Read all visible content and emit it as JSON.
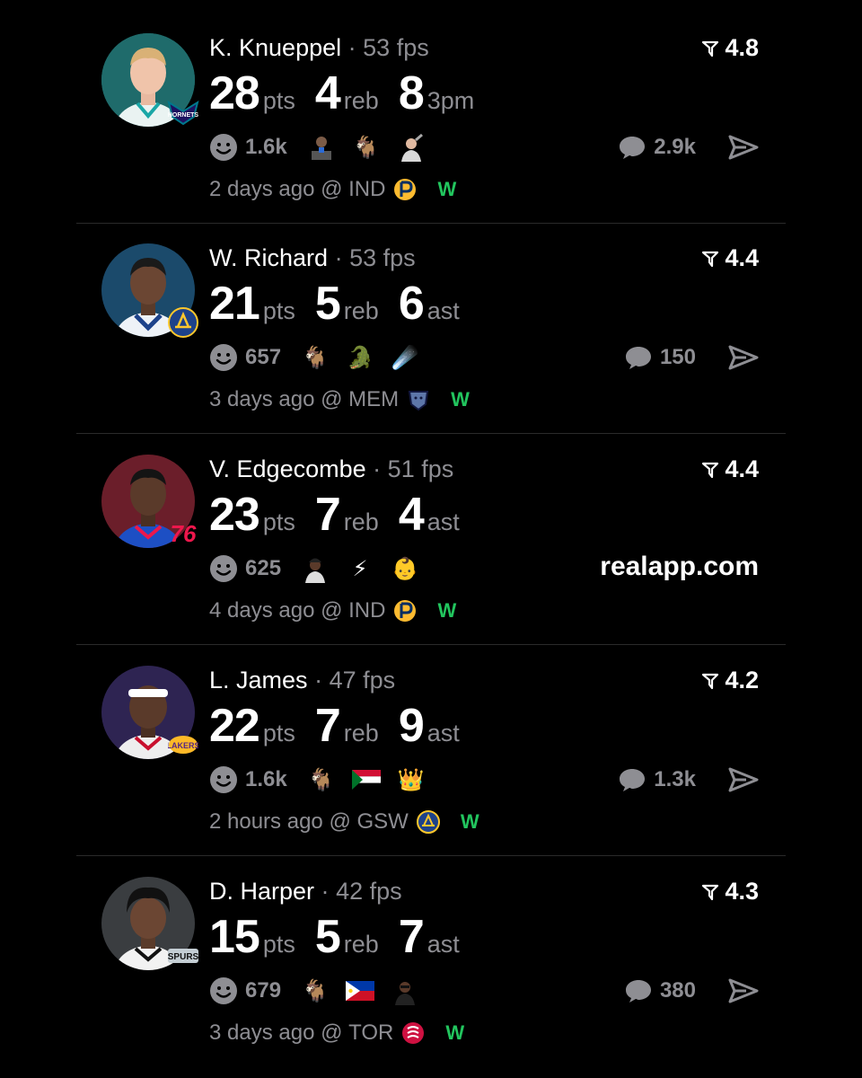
{
  "ui": {
    "colors": {
      "background": "#000000",
      "muted": "#8e8e93",
      "win": "#22c55e",
      "divider": "#2a2a2a"
    },
    "icons": {
      "rating": "rating-arrow-icon",
      "reaction": "smiley-icon",
      "comment": "comment-bubble-icon",
      "share": "send-icon"
    }
  },
  "feed": [
    {
      "player": "K. Knueppel",
      "separator": "·",
      "fps": "53 fps",
      "rating": "4.8",
      "team_logo": "hornets-logo",
      "stats": [
        {
          "value": "28",
          "unit": "pts"
        },
        {
          "value": "4",
          "unit": "reb"
        },
        {
          "value": "8",
          "unit": "3pm"
        }
      ],
      "reaction_count": "1.6k",
      "emojis": [
        "player-sticker-icon",
        "goat-icon",
        "player-sticker-icon"
      ],
      "comments": "2.9k",
      "time": "2 days ago",
      "at": "@",
      "opponent": "IND",
      "opponent_logo": "pacers-logo",
      "result": "W"
    },
    {
      "player": "W. Richard",
      "separator": "·",
      "fps": "53 fps",
      "rating": "4.4",
      "team_logo": "warriors-logo",
      "stats": [
        {
          "value": "21",
          "unit": "pts"
        },
        {
          "value": "5",
          "unit": "reb"
        },
        {
          "value": "6",
          "unit": "ast"
        }
      ],
      "reaction_count": "657",
      "emojis": [
        "goat-icon",
        "crocodile-icon",
        "comet-icon"
      ],
      "comments": "150",
      "time": "3 days ago",
      "at": "@",
      "opponent": "MEM",
      "opponent_logo": "grizzlies-logo",
      "result": "W"
    },
    {
      "player": "V. Edgecombe",
      "separator": "·",
      "fps": "51 fps",
      "rating": "4.4",
      "team_logo": "76ers-logo",
      "stats": [
        {
          "value": "23",
          "unit": "pts"
        },
        {
          "value": "7",
          "unit": "reb"
        },
        {
          "value": "4",
          "unit": "ast"
        }
      ],
      "reaction_count": "625",
      "emojis": [
        "player-sticker-icon",
        "lightning-icon",
        "baby-icon"
      ],
      "promo": "realapp.com",
      "time": "4 days ago",
      "at": "@",
      "opponent": "IND",
      "opponent_logo": "pacers-logo",
      "result": "W"
    },
    {
      "player": "L. James",
      "separator": "·",
      "fps": "47 fps",
      "rating": "4.2",
      "team_logo": "lakers-logo",
      "stats": [
        {
          "value": "22",
          "unit": "pts"
        },
        {
          "value": "7",
          "unit": "reb"
        },
        {
          "value": "9",
          "unit": "ast"
        }
      ],
      "reaction_count": "1.6k",
      "emojis": [
        "goat-icon",
        "sudan-flag-icon",
        "crown-icon"
      ],
      "comments": "1.3k",
      "time": "2 hours ago",
      "at": "@",
      "opponent": "GSW",
      "opponent_logo": "warriors-logo",
      "result": "W"
    },
    {
      "player": "D. Harper",
      "separator": "·",
      "fps": "42 fps",
      "rating": "4.3",
      "team_logo": "spurs-logo",
      "stats": [
        {
          "value": "15",
          "unit": "pts"
        },
        {
          "value": "5",
          "unit": "reb"
        },
        {
          "value": "7",
          "unit": "ast"
        }
      ],
      "reaction_count": "679",
      "emojis": [
        "goat-icon",
        "philippines-flag-icon",
        "player-sticker-icon"
      ],
      "comments": "380",
      "time": "3 days ago",
      "at": "@",
      "opponent": "TOR",
      "opponent_logo": "raptors-logo",
      "result": "W"
    }
  ]
}
